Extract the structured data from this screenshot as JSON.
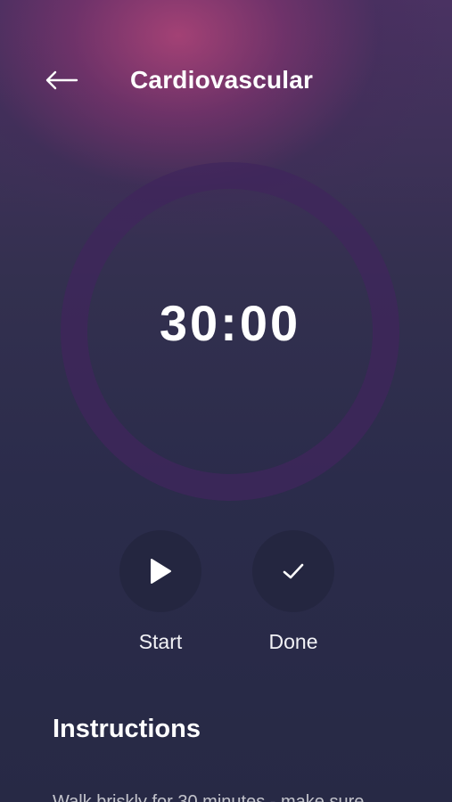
{
  "header": {
    "back_icon": "arrow-left-icon",
    "title": "Cardiovascular"
  },
  "timer": {
    "display": "30:00"
  },
  "controls": {
    "start": {
      "icon": "play-icon",
      "label": "Start"
    },
    "done": {
      "icon": "check-icon",
      "label": "Done"
    }
  },
  "instructions": {
    "heading": "Instructions",
    "text": "Walk briskly for 30 minutes - make sure"
  },
  "colors": {
    "background": "#272945",
    "accent_glow": "#a84276",
    "ring": "#40265c",
    "button_bg": "#242640",
    "text": "#ffffff"
  }
}
